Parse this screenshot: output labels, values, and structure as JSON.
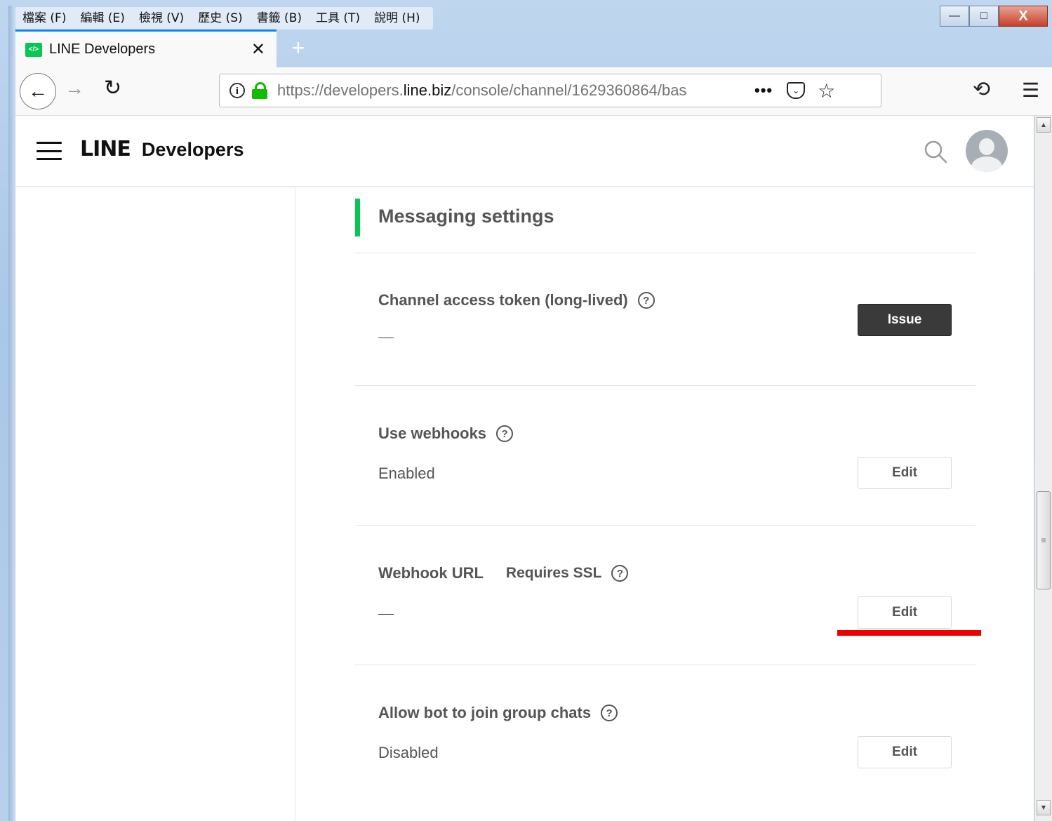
{
  "menubar": {
    "items": [
      "檔案 (F)",
      "編輯 (E)",
      "檢視 (V)",
      "歷史 (S)",
      "書籤 (B)",
      "工具 (T)",
      "說明 (H)"
    ]
  },
  "window_controls": {
    "minimize": "—",
    "maximize": "□",
    "close": "X"
  },
  "tab": {
    "favicon": "</>",
    "title": "LINE Developers",
    "close": "✕"
  },
  "new_tab": "+",
  "navbar": {
    "url_prefix": "https://developers.",
    "url_host": "line.biz",
    "url_path": "/console/channel/1629360864/bas",
    "more": "•••"
  },
  "header": {
    "brand_line": "LINE",
    "brand_dev": "Developers"
  },
  "section": {
    "title": "Messaging settings"
  },
  "rows": {
    "token": {
      "label": "Channel access token (long-lived)",
      "button": "Issue"
    },
    "webhooks": {
      "label": "Use webhooks",
      "value": "Enabled",
      "button": "Edit"
    },
    "webhook_url": {
      "label": "Webhook URL",
      "ssl": "Requires SSL",
      "button": "Edit"
    },
    "group_chats": {
      "label": "Allow bot to join group chats",
      "value": "Disabled",
      "button": "Edit"
    }
  },
  "help_glyph": "?",
  "colors": {
    "accent": "#06c755",
    "highlight": "#ee0000",
    "dark_button": "#3a3a3a"
  },
  "icons": [
    "back-arrow-icon",
    "forward-arrow-icon",
    "reload-icon",
    "info-icon",
    "lock-icon",
    "pocket-icon",
    "star-icon",
    "history-icon",
    "hamburger-menu-icon",
    "search-icon",
    "avatar-icon",
    "help-icon"
  ]
}
